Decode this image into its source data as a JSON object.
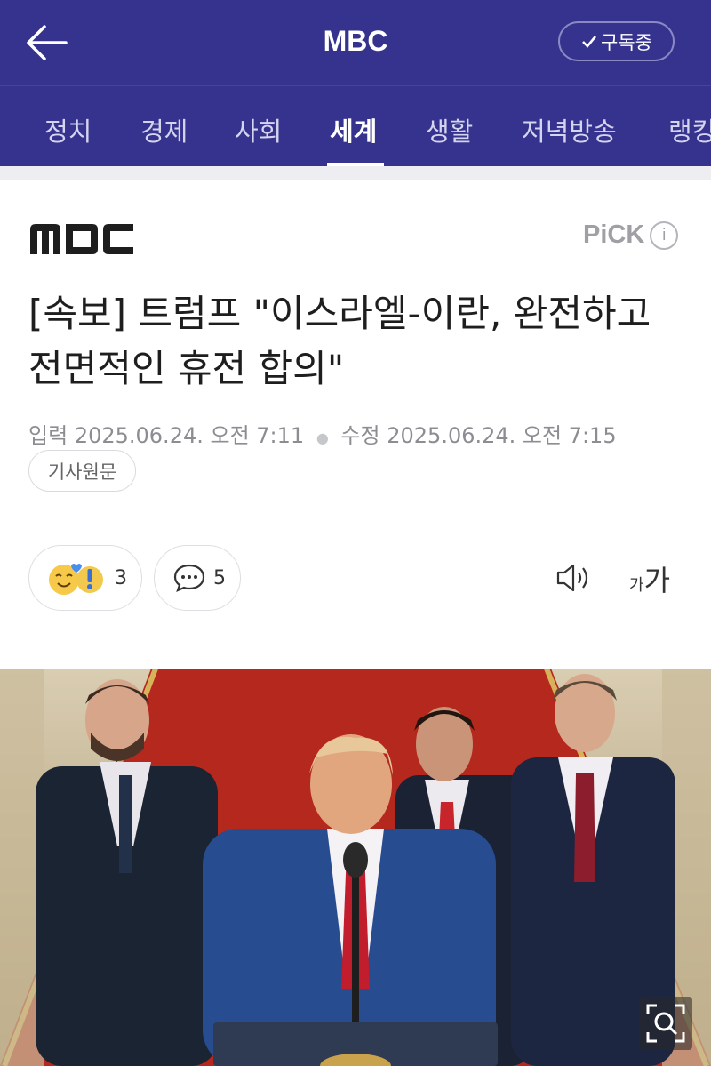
{
  "header": {
    "title": "MBC",
    "subscribe_label": "구독중"
  },
  "nav": {
    "tabs": [
      {
        "label": "정치"
      },
      {
        "label": "경제"
      },
      {
        "label": "사회"
      },
      {
        "label": "세계",
        "active": true
      },
      {
        "label": "생활"
      },
      {
        "label": "저녁방송"
      },
      {
        "label": "랭킹"
      }
    ]
  },
  "article": {
    "press_logo": "MBC",
    "pick_label": "PiCK",
    "title": "[속보] 트럼프 \"이스라엘-이란, 완전하고 전면적인 휴전 합의\"",
    "published_label": "입력",
    "published": "2025.06.24. 오전 7:11",
    "updated_label": "수정",
    "updated": "2025.06.24. 오전 7:15",
    "source_button": "기사원문",
    "reaction_count": "3",
    "comment_count": "5",
    "font_small": "가",
    "font_large": "가"
  },
  "colors": {
    "header_bg": "#35338e",
    "gap_bg": "#eeeef2"
  },
  "icons": [
    "back-arrow-icon",
    "check-icon",
    "info-icon",
    "reaction-emoji-icon",
    "comment-bubble-icon",
    "speaker-icon",
    "zoom-icon"
  ]
}
